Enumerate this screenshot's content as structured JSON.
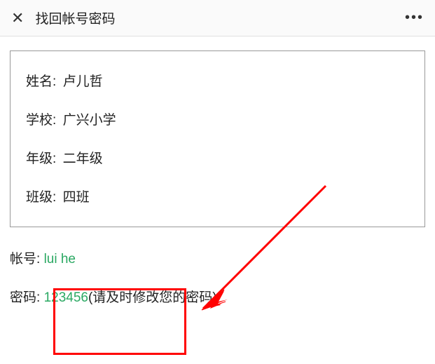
{
  "header": {
    "title": "找回帐号密码"
  },
  "info": {
    "name_label": "姓名:",
    "name_value": "卢儿哲",
    "school_label": "学校:",
    "school_value": "广兴小学",
    "grade_label": "年级:",
    "grade_value": "二年级",
    "class_label": "班级:",
    "class_value": "四班"
  },
  "credentials": {
    "account_label": "帐号:",
    "account_value": "lui        he",
    "password_label": "密码:",
    "password_value": "123456",
    "password_hint": "(请及时修改您的密码)"
  },
  "annotation": {
    "highlight_color": "#ff0000"
  }
}
